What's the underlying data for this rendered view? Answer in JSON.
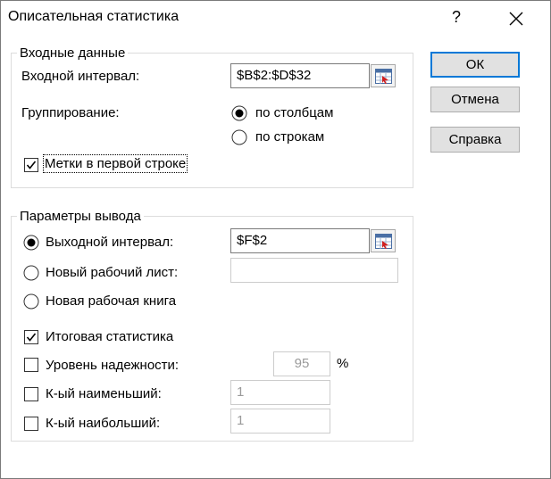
{
  "window": {
    "title": "Описательная статистика",
    "help_label": "?",
    "close_icon": "close-icon"
  },
  "input_group": {
    "legend": "Входные данные",
    "range_label": "Входной интервал:",
    "range_value": "$B$2:$D$32",
    "grouping_label": "Группирование:",
    "by_columns": "по столбцам",
    "by_rows": "по строкам",
    "grouping_selected": "по столбцам",
    "labels_first_row": "Метки в первой строке",
    "labels_first_row_checked": true
  },
  "output_group": {
    "legend": "Параметры вывода",
    "output_range_label": "Выходной интервал:",
    "output_range_value": "$F$2",
    "new_sheet_label": "Новый рабочий лист:",
    "new_sheet_value": "",
    "new_book_label": "Новая рабочая книга",
    "selected_output": "Выходной интервал:",
    "summary_stats_label": "Итоговая статистика",
    "summary_stats_checked": true,
    "confidence_label": "Уровень надежности:",
    "confidence_value": "95",
    "confidence_unit": "%",
    "confidence_checked": false,
    "kth_smallest_label": "К-ый наименьший:",
    "kth_smallest_value": "1",
    "kth_smallest_checked": false,
    "kth_largest_label": "К-ый наибольший:",
    "kth_largest_value": "1",
    "kth_largest_checked": false
  },
  "buttons": {
    "ok": "ОК",
    "cancel": "Отмена",
    "help": "Справка"
  }
}
